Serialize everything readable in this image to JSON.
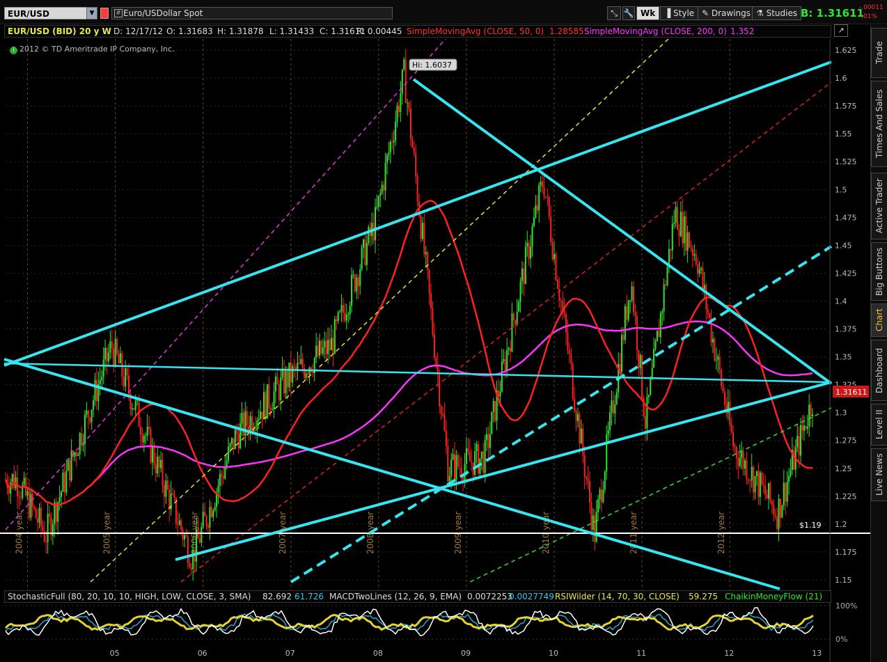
{
  "header": {
    "symbol": "EUR/USD",
    "description": "Euro/USDollar Spot",
    "period_button": "Wk",
    "style_button": "Style",
    "drawings_button": "Drawings",
    "studies_button": "Studies",
    "bid": "B: 1.31611",
    "change_abs": "-.00011",
    "change_pct": "-.01%"
  },
  "infobar": {
    "symbol": "EUR/USD (BID) 20 y W",
    "date": "D: 12/17/12",
    "open": "O: 1.31683",
    "high": "H: 1.31878",
    "low": "L: 1.31433",
    "close": "C: 1.31611",
    "range": "R: 0.00445",
    "sma50_label": "SimpleMovingAvg (CLOSE, 50, 0)",
    "sma50_value": "1.28585",
    "sma200_label": "SimpleMovingAvg (CLOSE, 200, 0)",
    "sma200_value": "1.352"
  },
  "copyright": "2012 © TD Ameritrade IP Company, Inc.",
  "annotations": {
    "high": "Hi: 1.6037",
    "support": "$1.19",
    "last_price": "1.31611"
  },
  "side_tabs": [
    "Trade",
    "Times And Sales",
    "Active Trader",
    "Big Buttons",
    "Chart",
    "Dashboard",
    "Level II",
    "Live News"
  ],
  "lower": {
    "stoch_label": "StochasticFull (80, 20, 10, 10, HIGH, LOW, CLOSE, 3, SMA)",
    "stoch_v1": "82.692",
    "stoch_v2": "61.726",
    "macd_label": "MACDTwoLines (12, 26, 9, EMA)",
    "macd_v1": "0.0072253",
    "macd_v2": "0.0027749",
    "rsi_label": "RSIWilder (14, 70, 30, CLOSE)",
    "rsi_v": "59.275",
    "cmf_label": "ChaikinMoneyFlow (21)",
    "pct_high": "100%",
    "pct_low": "0%"
  },
  "colors": {
    "up": "#2ee62e",
    "down": "#ff2020",
    "sma50": "#ff2020",
    "sma200": "#ff33ff",
    "trendline": "#33e6f0",
    "background": "#000000"
  },
  "chart_data": {
    "type": "candlestick",
    "ylim": [
      1.14,
      1.635
    ],
    "y_ticks": [
      "1.625",
      "1.6",
      "1.575",
      "1.55",
      "1.525",
      "1.5",
      "1.475",
      "1.45",
      "1.425",
      "1.4",
      "1.375",
      "1.35",
      "1.325",
      "1.3",
      "1.275",
      "1.25",
      "1.225",
      "1.2",
      "1.175",
      "1.15"
    ],
    "year_labels": [
      "2004 year",
      "2005 year",
      "2006 year",
      "2007 year",
      "2008 year",
      "2009 year",
      "2010 year",
      "2011 year",
      "2012 year"
    ],
    "x_labels": [
      "05",
      "06",
      "07",
      "08",
      "09",
      "10",
      "11",
      "12",
      "13"
    ],
    "anchor_closes": [
      {
        "x": "2003-11",
        "y": 1.24
      },
      {
        "x": "2004-03",
        "y": 1.19
      },
      {
        "x": "2004-12",
        "y": 1.36
      },
      {
        "x": "2005-11",
        "y": 1.17
      },
      {
        "x": "2006-05",
        "y": 1.28
      },
      {
        "x": "2006-12",
        "y": 1.33
      },
      {
        "x": "2007-06",
        "y": 1.36
      },
      {
        "x": "2007-12",
        "y": 1.47
      },
      {
        "x": "2008-04",
        "y": 1.6037
      },
      {
        "x": "2008-10",
        "y": 1.25
      },
      {
        "x": "2009-03",
        "y": 1.26
      },
      {
        "x": "2009-11",
        "y": 1.51
      },
      {
        "x": "2010-06",
        "y": 1.19
      },
      {
        "x": "2010-11",
        "y": 1.42
      },
      {
        "x": "2011-01",
        "y": 1.29
      },
      {
        "x": "2011-05",
        "y": 1.48
      },
      {
        "x": "2011-08",
        "y": 1.44
      },
      {
        "x": "2012-01",
        "y": 1.27
      },
      {
        "x": "2012-07",
        "y": 1.21
      },
      {
        "x": "2012-12",
        "y": 1.3161
      }
    ]
  }
}
